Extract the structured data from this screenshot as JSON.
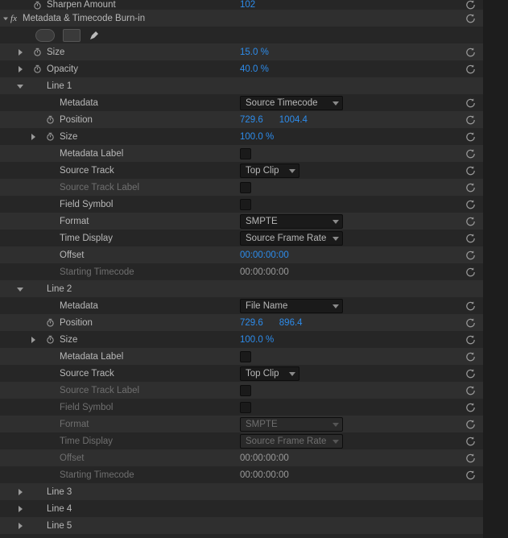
{
  "top": {
    "sharpen_label": "Sharpen Amount",
    "sharpen_value": "102"
  },
  "effect": {
    "title": "Metadata & Timecode Burn-in",
    "size_label": "Size",
    "size_value": "15.0 %",
    "opacity_label": "Opacity",
    "opacity_value": "40.0 %"
  },
  "line1": {
    "title": "Line 1",
    "metadata_label": "Metadata",
    "metadata_value": "Source Timecode",
    "position_label": "Position",
    "position_x": "729.6",
    "position_y": "1004.4",
    "size_label": "Size",
    "size_value": "100.0 %",
    "metadata_label_label": "Metadata Label",
    "source_track_label": "Source Track",
    "source_track_value": "Top Clip",
    "source_track_label_label": "Source Track Label",
    "field_symbol_label": "Field Symbol",
    "format_label": "Format",
    "format_value": "SMPTE",
    "time_display_label": "Time Display",
    "time_display_value": "Source Frame Rate",
    "offset_label": "Offset",
    "offset_value": "00:00:00:00",
    "starting_tc_label": "Starting Timecode",
    "starting_tc_value": "00:00:00:00"
  },
  "line2": {
    "title": "Line 2",
    "metadata_label": "Metadata",
    "metadata_value": "File Name",
    "position_label": "Position",
    "position_x": "729.6",
    "position_y": "896.4",
    "size_label": "Size",
    "size_value": "100.0 %",
    "metadata_label_label": "Metadata Label",
    "source_track_label": "Source Track",
    "source_track_value": "Top Clip",
    "source_track_label_label": "Source Track Label",
    "field_symbol_label": "Field Symbol",
    "format_label": "Format",
    "format_value": "SMPTE",
    "time_display_label": "Time Display",
    "time_display_value": "Source Frame Rate",
    "offset_label": "Offset",
    "offset_value": "00:00:00:00",
    "starting_tc_label": "Starting Timecode",
    "starting_tc_value": "00:00:00:00"
  },
  "line3": {
    "title": "Line 3"
  },
  "line4": {
    "title": "Line 4"
  },
  "line5": {
    "title": "Line 5"
  }
}
